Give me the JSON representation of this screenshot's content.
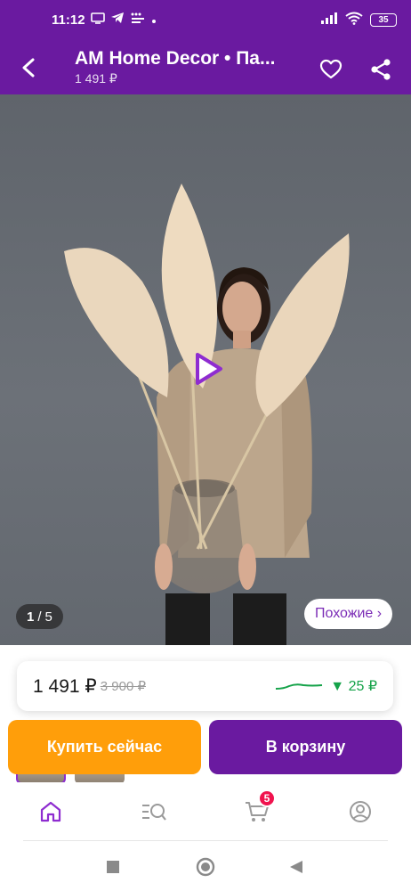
{
  "status_bar": {
    "time": "11:12",
    "battery": "35"
  },
  "header": {
    "title": "AM Home Decor • Па...",
    "subtitle": "1 491 ₽"
  },
  "media": {
    "counter_current": "1",
    "counter_sep": "/",
    "counter_total": "5",
    "similar_label": "Похожие ›"
  },
  "price_card": {
    "price": "1 491 ₽",
    "old_price": "3 900 ₽",
    "trend_value": "▼ 25 ₽",
    "trend_color": "#16a34a"
  },
  "actions": {
    "buy_now_label": "Купить сейчас",
    "add_to_cart_label": "В корзину",
    "buy_color": "#ff9e0a",
    "cart_color": "#6a1aa0"
  },
  "bottom_nav": {
    "items": [
      {
        "icon": "home-icon"
      },
      {
        "icon": "catalog-search-icon"
      },
      {
        "icon": "cart-icon",
        "badge": "5"
      },
      {
        "icon": "profile-icon"
      }
    ]
  },
  "colors": {
    "brand": "#6a1aa0",
    "accent_active": "#8e2cd0"
  }
}
